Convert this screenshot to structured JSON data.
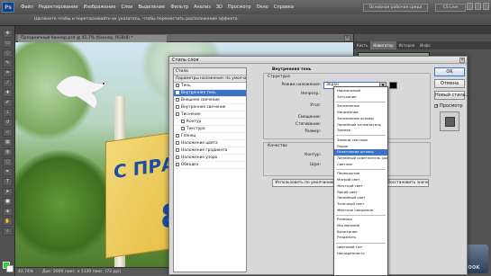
{
  "menubar": {
    "logo": "Ps",
    "items": [
      "Файл",
      "Редактирование",
      "Изображение",
      "Слои",
      "Выделение",
      "Фильтр",
      "Анализ",
      "3D",
      "Просмотр",
      "Окно",
      "Справка"
    ],
    "workspace_button": "Основная рабочая среда",
    "cs_live": "CS Live"
  },
  "options_bar": {
    "text": "Щелкните чтобы и перетаскивайте их указатель, чтобы переместить расположение эффекта."
  },
  "document": {
    "tab_title": "Праздничный баннер.psd @ 42,7% (баннер, RGB/8) *",
    "zoom": "42,74%",
    "doc_info": "Док: 2000 пикс. x 1330 пикс. (72 ppi)",
    "banner_text_top": "С ПРАЗ",
    "banner_text_num": "8"
  },
  "panels": {
    "tabs": [
      "Кисть",
      "Навигатор",
      "История",
      "Инфо"
    ],
    "active_tab": "Навигатор"
  },
  "dialog": {
    "title": "Стиль слоя",
    "close_glyph": "×",
    "styles_header": "Стили",
    "styles_items": [
      {
        "label": "Параметры наложения: по умолчанию",
        "checkbox": false,
        "selected": false,
        "indent": false,
        "header": true
      },
      {
        "label": "Тень",
        "checkbox": true,
        "selected": false,
        "indent": false
      },
      {
        "label": "Внутренняя тень",
        "checkbox": true,
        "selected": true,
        "indent": false
      },
      {
        "label": "Внешнее свечение",
        "checkbox": true,
        "selected": false,
        "indent": false
      },
      {
        "label": "Внутреннее свечение",
        "checkbox": true,
        "selected": false,
        "indent": false
      },
      {
        "label": "Тиснение",
        "checkbox": true,
        "selected": false,
        "indent": false
      },
      {
        "label": "Контур",
        "checkbox": true,
        "selected": false,
        "indent": true
      },
      {
        "label": "Текстура",
        "checkbox": true,
        "selected": false,
        "indent": true
      },
      {
        "label": "Глянец",
        "checkbox": true,
        "selected": false,
        "indent": false
      },
      {
        "label": "Наложение цвета",
        "checkbox": true,
        "selected": false,
        "indent": false
      },
      {
        "label": "Наложение градиента",
        "checkbox": true,
        "selected": false,
        "indent": false
      },
      {
        "label": "Наложение узора",
        "checkbox": true,
        "selected": false,
        "indent": false
      },
      {
        "label": "Обводка",
        "checkbox": true,
        "selected": false,
        "indent": false
      }
    ],
    "section_title": "Внутренняя тень",
    "structure_title": "Структура",
    "blend_label": "Режим наложения:",
    "blend_value": "Экран",
    "opacity_label": "Непрозр.:",
    "angle_label": "Угол:",
    "offset_label": "Смещение:",
    "choke_label": "Стягивание:",
    "size_label": "Размер:",
    "quality_title": "Качество",
    "contour_label": "Контур:",
    "noise_label": "Шум:",
    "default_button": "Использовать по умолчанию",
    "reset_button": "Восстановить значения по умолчанию",
    "ok": "OK",
    "cancel": "Отмена",
    "new_style": "Новый стиль...",
    "preview_label": "Просмотр",
    "preview_checked": true
  },
  "blend_dropdown": {
    "selected_index": 9,
    "groups": [
      [
        "Нормальный",
        "Затухание"
      ],
      [
        "Затемнение",
        "Умножение",
        "Затемнение основы",
        "Линейный затемнитель",
        "Темнее"
      ],
      [
        "Замена светлым",
        "Экран",
        "Осветление основы",
        "Линейный осветлитель (добавить)",
        "Светлее"
      ],
      [
        "Перекрытие",
        "Мягкий свет",
        "Жесткий свет",
        "Яркий свет",
        "Линейный свет",
        "Точечный свет",
        "Жесткое смешение"
      ],
      [
        "Разница",
        "Исключение",
        "Вычитание",
        "Разделить"
      ],
      [
        "Цветовой тон",
        "Насыщенность"
      ]
    ]
  },
  "watermark": {
    "text": "NOTEBOOK"
  }
}
